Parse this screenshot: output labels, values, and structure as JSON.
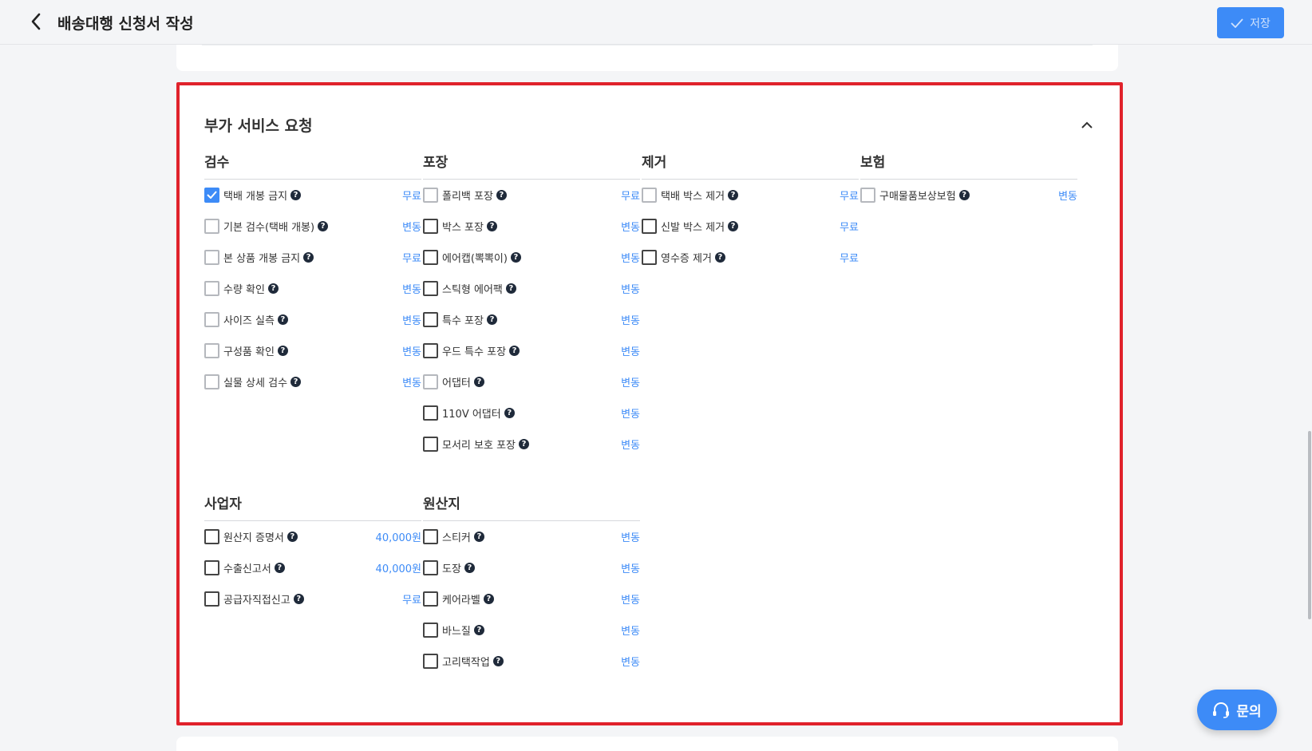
{
  "header": {
    "title": "배송대행 신청서 작성",
    "save_label": "저장"
  },
  "section": {
    "title": "부가 서비스 요청"
  },
  "colors": {
    "accent": "#3d8bf7",
    "highlight_border": "#e0222b"
  },
  "groups": [
    {
      "title": "검수",
      "options": [
        {
          "label": "택배 개봉 금지",
          "price": "무료",
          "checked": true
        },
        {
          "label": "기본 검수(택배 개봉)",
          "price": "변동",
          "checked": false
        },
        {
          "label": "본 상품 개봉 금지",
          "price": "무료",
          "checked": false
        },
        {
          "label": "수량 확인",
          "price": "변동",
          "checked": false
        },
        {
          "label": "사이즈 실측",
          "price": "변동",
          "checked": false
        },
        {
          "label": "구성품 확인",
          "price": "변동",
          "checked": false
        },
        {
          "label": "실물 상세 검수",
          "price": "변동",
          "checked": false
        }
      ]
    },
    {
      "title": "포장",
      "options": [
        {
          "label": "폴리백 포장",
          "price": "무료",
          "checked": false
        },
        {
          "label": "박스 포장",
          "price": "변동",
          "checked": false
        },
        {
          "label": "에어캡(뽁뽁이)",
          "price": "변동",
          "checked": false
        },
        {
          "label": "스틱형 에어팩",
          "price": "변동",
          "checked": false
        },
        {
          "label": "특수 포장",
          "price": "변동",
          "checked": false
        },
        {
          "label": "우드 특수 포장",
          "price": "변동",
          "checked": false
        },
        {
          "label": "어댑터",
          "price": "변동",
          "checked": false
        },
        {
          "label": "110V 어댑터",
          "price": "변동",
          "checked": false
        },
        {
          "label": "모서리 보호 포장",
          "price": "변동",
          "checked": false
        }
      ]
    },
    {
      "title": "제거",
      "options": [
        {
          "label": "택배 박스 제거",
          "price": "무료",
          "checked": false
        },
        {
          "label": "신발 박스 제거",
          "price": "무료",
          "checked": false
        },
        {
          "label": "영수증 제거",
          "price": "무료",
          "checked": false
        }
      ]
    },
    {
      "title": "보험",
      "options": [
        {
          "label": "구매물품보상보험",
          "price": "변동",
          "checked": false
        }
      ]
    },
    {
      "title": "사업자",
      "options": [
        {
          "label": "원산지 증명서",
          "price": "40,000원",
          "checked": false
        },
        {
          "label": "수출신고서",
          "price": "40,000원",
          "checked": false
        },
        {
          "label": "공급자직접신고",
          "price": "무료",
          "checked": false
        }
      ]
    },
    {
      "title": "원산지",
      "options": [
        {
          "label": "스티커",
          "price": "변동",
          "checked": false
        },
        {
          "label": "도장",
          "price": "변동",
          "checked": false
        },
        {
          "label": "케어라벨",
          "price": "변동",
          "checked": false
        },
        {
          "label": "바느질",
          "price": "변동",
          "checked": false
        },
        {
          "label": "고리택작업",
          "price": "변동",
          "checked": false
        }
      ]
    }
  ],
  "chat": {
    "label": "문의"
  }
}
